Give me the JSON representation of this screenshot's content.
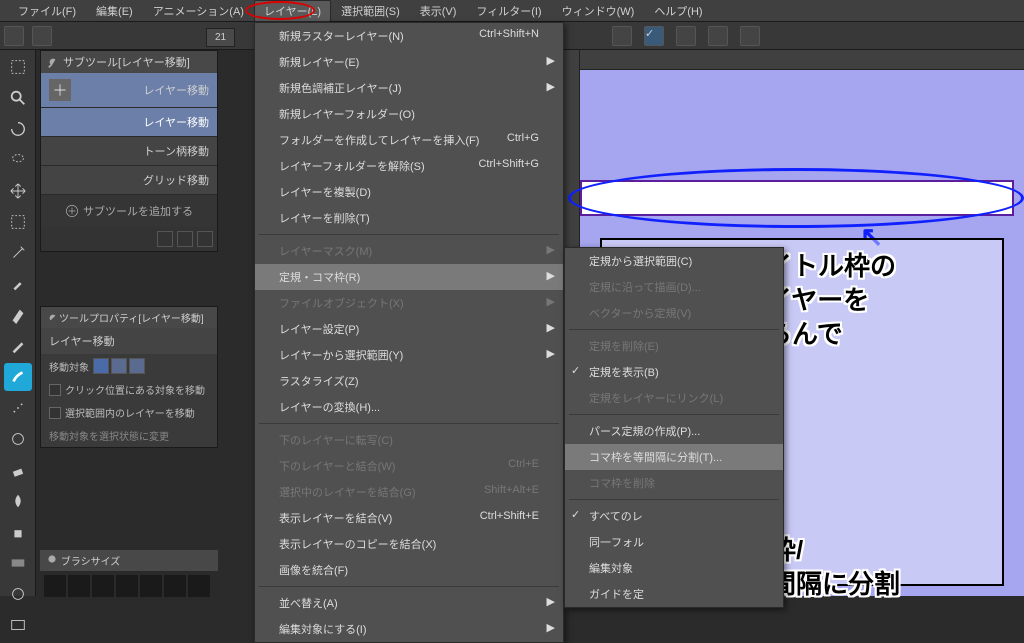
{
  "menubar": {
    "items": [
      "ファイル(F)",
      "編集(E)",
      "アニメーション(A)",
      "レイヤー(L)",
      "選択範囲(S)",
      "表示(V)",
      "フィルター(I)",
      "ウィンドウ(W)",
      "ヘルプ(H)"
    ],
    "open_index": 3
  },
  "toolbar": {
    "tab": "21"
  },
  "subtool_panel": {
    "title": "サブツール[レイヤー移動]",
    "items": [
      {
        "label": "レイヤー移動",
        "selected": true
      },
      {
        "label": "レイヤー移動"
      },
      {
        "label": "トーン柄移動"
      },
      {
        "label": "グリッド移動"
      }
    ],
    "add": "サブツールを追加する"
  },
  "toolprop_panel": {
    "title": "ツールプロパティ[レイヤー移動]",
    "header": "レイヤー移動",
    "opt_label": "移動対象",
    "rows": [
      "クリック位置にある対象を移動",
      "選択範囲内のレイヤーを移動",
      "移動対象を選択状態に変更"
    ]
  },
  "brush_panel": {
    "title": "ブラシサイズ"
  },
  "dropdown_layer": {
    "items": [
      {
        "label": "新規ラスターレイヤー(N)",
        "sc": "Ctrl+Shift+N"
      },
      {
        "label": "新規レイヤー(E)",
        "sub": true
      },
      {
        "label": "新規色調補正レイヤー(J)",
        "sub": true
      },
      {
        "label": "新規レイヤーフォルダー(O)"
      },
      {
        "label": "フォルダーを作成してレイヤーを挿入(F)",
        "sc": "Ctrl+G"
      },
      {
        "label": "レイヤーフォルダーを解除(S)",
        "sc": "Ctrl+Shift+G"
      },
      {
        "label": "レイヤーを複製(D)"
      },
      {
        "label": "レイヤーを削除(T)"
      },
      {
        "sep": true
      },
      {
        "label": "レイヤーマスク(M)",
        "sub": true,
        "disabled": true
      },
      {
        "label": "定規・コマ枠(R)",
        "sub": true,
        "hover": true,
        "ellipse": true
      },
      {
        "label": "ファイルオブジェクト(X)",
        "sub": true,
        "disabled": true
      },
      {
        "label": "レイヤー設定(P)",
        "sub": true
      },
      {
        "label": "レイヤーから選択範囲(Y)",
        "sub": true
      },
      {
        "label": "ラスタライズ(Z)"
      },
      {
        "label": "レイヤーの変換(H)..."
      },
      {
        "sep": true
      },
      {
        "label": "下のレイヤーに転写(C)",
        "disabled": true
      },
      {
        "label": "下のレイヤーと結合(W)",
        "sc": "Ctrl+E",
        "disabled": true
      },
      {
        "label": "選択中のレイヤーを結合(G)",
        "sc": "Shift+Alt+E",
        "disabled": true
      },
      {
        "label": "表示レイヤーを結合(V)",
        "sc": "Ctrl+Shift+E"
      },
      {
        "label": "表示レイヤーのコピーを結合(X)"
      },
      {
        "label": "画像を統合(F)"
      },
      {
        "sep": true
      },
      {
        "label": "並べ替え(A)",
        "sub": true
      },
      {
        "label": "編集対象にする(I)",
        "sub": true
      }
    ]
  },
  "dropdown_ruler": {
    "items": [
      {
        "label": "定規から選択範囲(C)"
      },
      {
        "label": "定規に沿って描画(D)...",
        "disabled": true
      },
      {
        "label": "ベクターから定規(V)",
        "disabled": true
      },
      {
        "sep": true
      },
      {
        "label": "定規を削除(E)",
        "disabled": true
      },
      {
        "label": "定規を表示(B)",
        "check": true
      },
      {
        "label": "定規をレイヤーにリンク(L)",
        "disabled": true
      },
      {
        "sep": true
      },
      {
        "label": "パース定規の作成(P)..."
      },
      {
        "label": "コマ枠を等間隔に分割(T)...",
        "hover": true,
        "ellipse": true
      },
      {
        "label": "コマ枠を削除",
        "disabled": true
      },
      {
        "sep": true
      },
      {
        "label": "すべてのレ",
        "check": true
      },
      {
        "label": "同一フォル"
      },
      {
        "label": "編集対象"
      },
      {
        "label": "ガイドを定"
      }
    ]
  },
  "annotations": {
    "arrow": "↖",
    "a1": "タイトル枠の\nレイヤーを\nえらんで",
    "a2": "レイヤー/\n定規・コマ枠/\nコマ枠を等間隔に分割"
  }
}
